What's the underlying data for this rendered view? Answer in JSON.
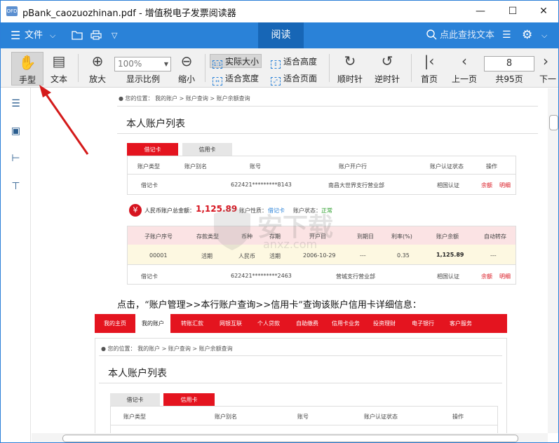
{
  "window": {
    "app_icon_text": "OFD",
    "title": "pBank_caozuozhinan.pdf - 增值税电子发票阅读器",
    "min": "—",
    "max": "☐",
    "close": "✕"
  },
  "menubar": {
    "file_label": "文件",
    "read_tab": "阅读",
    "search_placeholder": "点此查找文本"
  },
  "toolbar": {
    "hand": "手型",
    "text": "文本",
    "zoom_in": "放大",
    "zoom_value": "100%",
    "display_ratio": "显示比例",
    "zoom_out": "缩小",
    "actual_size": "实际大小",
    "fit_height": "适合高度",
    "fit_width": "适合宽度",
    "fit_page": "适合页面",
    "clockwise": "顺时针",
    "counterclockwise": "逆时针",
    "first_page": "首页",
    "prev_page": "上一页",
    "page_number": "8",
    "total_pages": "共95页",
    "next_page": "下一"
  },
  "doc": {
    "crumb1": "您的位置： 我的账户  >  账户查询  >  账户余额查询",
    "title1": "本人账户列表",
    "tab_debit": "借记卡",
    "tab_credit": "信用卡",
    "headers1": [
      "账户类型",
      "账户别名",
      "账号",
      "账户开户行",
      "账户认证状态",
      "操作"
    ],
    "row1": [
      "借记卡",
      "622421*********8143",
      "南昌大世界支行营业部",
      "相国认证",
      "余额",
      "明细"
    ],
    "rmb_label": "人民币账户总金额：",
    "rmb_amount": "1,125.89",
    "acct_nature": "账户性质：",
    "acct_nature_val": "借记卡",
    "acct_status": "账户状态：",
    "acct_status_val": "正常",
    "headers2": [
      "子账户序号",
      "存款类型",
      "币种",
      "存期",
      "开户日",
      "到期日",
      "利率(%)",
      "账户余额",
      "自动转存"
    ],
    "row2": [
      "00001",
      "活期",
      "人民币",
      "活期",
      "2006-10-29",
      "---",
      "0.35",
      "1,125.89",
      "---"
    ],
    "row3": [
      "借记卡",
      "622421*********2463",
      "营城支行营业部",
      "相国认证",
      "余额",
      "明细"
    ],
    "paragraph": "点击，“账户管理>>本行账户查询>>信用卡”查询该账户信用卡详细信息：",
    "nav": [
      "我的主页",
      "我的账户",
      "转账汇款",
      "网银互联",
      "个人贷款",
      "自助缴费",
      "信用卡业务",
      "投资理财",
      "电子银行",
      "客户服务"
    ],
    "crumb2": "您的位置： 我的账户  >  账户查询  >  账户余额查询",
    "title2": "本人账户列表",
    "headers3": [
      "账户类型",
      "账户别名",
      "账号",
      "账户认证状态",
      "操作"
    ],
    "watermark": "安下载",
    "watermark_url": "anxz.com"
  },
  "colors": {
    "brand_blue": "#2a82d8",
    "active_tab": "#1766b6",
    "bank_red": "#e4141f"
  }
}
